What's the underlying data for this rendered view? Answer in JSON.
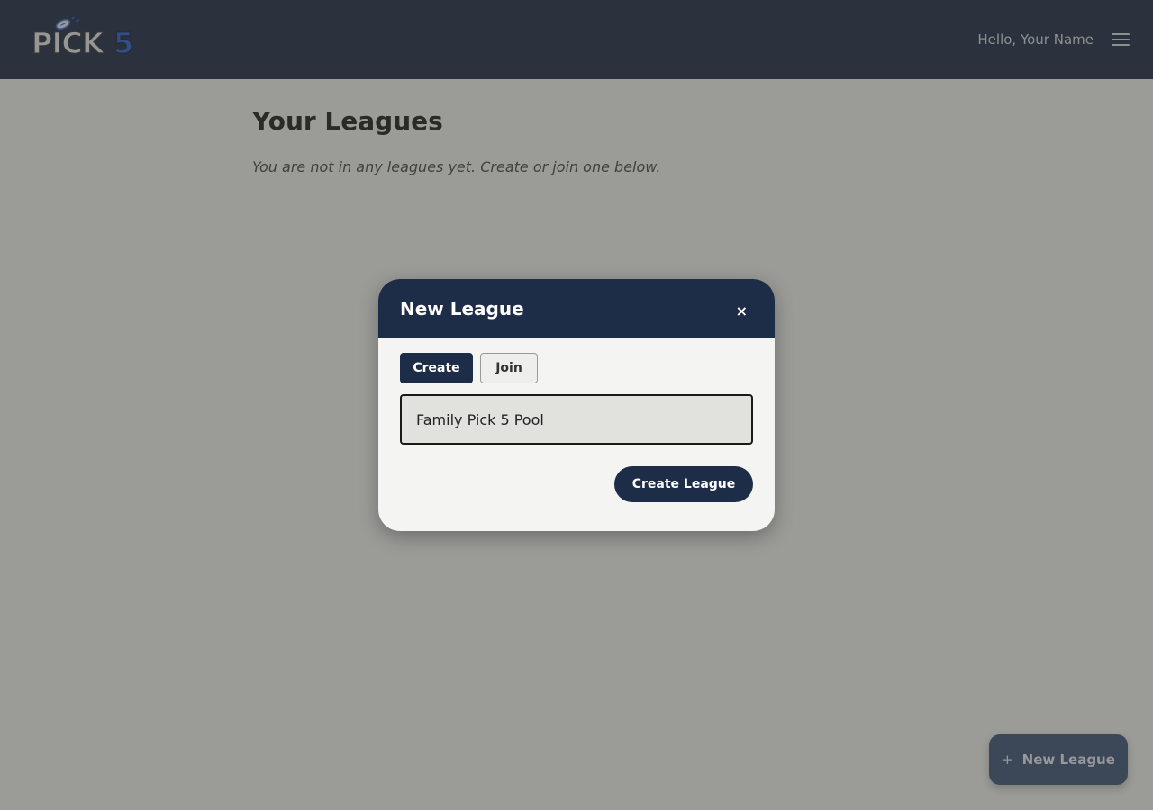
{
  "header": {
    "logo_text": "PICK5",
    "greeting": "Hello, Your Name",
    "menu_icon": "hamburger-menu-icon"
  },
  "main": {
    "title": "Your Leagues",
    "empty_message": "You are not in any leagues yet. Create or join one below."
  },
  "fab": {
    "icon": "+",
    "label": "New League"
  },
  "modal": {
    "title": "New League",
    "close_icon": "×",
    "tabs": [
      {
        "label": "Create",
        "active": true
      },
      {
        "label": "Join",
        "active": false
      }
    ],
    "league_name_value": "Family Pick 5 Pool",
    "submit_label": "Create League"
  },
  "colors": {
    "navy": "#1d2c47",
    "header_bg": "#1b2a44",
    "logo_blue": "#2b5ccf",
    "fab_bg": "#3d5478"
  }
}
